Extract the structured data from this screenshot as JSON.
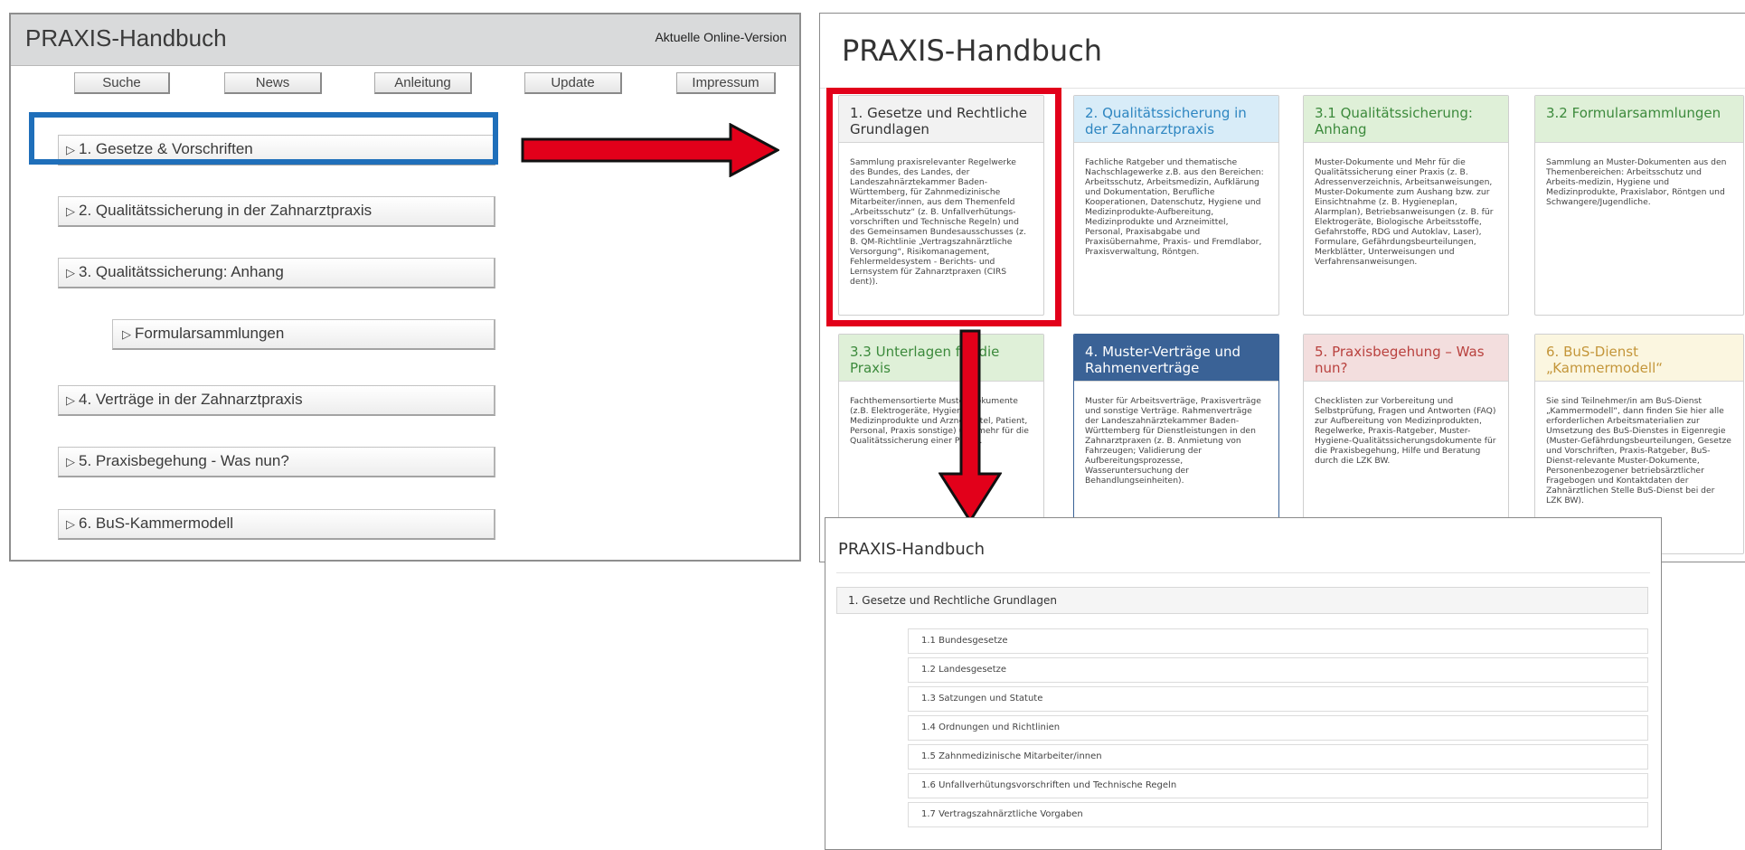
{
  "old_version": {
    "title": "PRAXIS-Handbuch",
    "online_version_link": "Aktuelle Online-Version",
    "buttons": [
      "Suche",
      "News",
      "Anleitung",
      "Update",
      "Impressum"
    ],
    "items": [
      {
        "marker": "▷",
        "label": "1. Gesetze & Vorschriften"
      },
      {
        "marker": "▷",
        "label": "2. Qualitätssicherung in der Zahnarztpraxis"
      },
      {
        "marker": "▷",
        "label": "3. Qualitätssicherung: Anhang"
      },
      {
        "marker": "▷",
        "label": "Formularsammlungen"
      },
      {
        "marker": "▷",
        "label": "4. Verträge in der Zahnarztpraxis"
      },
      {
        "marker": "▷",
        "label": "5. Praxisbegehung - Was nun?"
      },
      {
        "marker": "▷",
        "label": "6. BuS-Kammermodell"
      }
    ],
    "highlight_color": "#1f6fba"
  },
  "new_version": {
    "title": "PRAXIS-Handbuch",
    "highlight_color": "#e2001a",
    "cards": [
      {
        "title": "1. Gesetze und Rechtliche Grundlagen",
        "color": "#f2f2f2",
        "text": "Sammlung praxisrelevanter Regelwerke des Bundes, des Landes, der Landeszahnärztekammer Baden-Württemberg, für Zahnmedizinische Mitarbeiter/innen, aus dem Themenfeld „Arbeitsschutz“ (z. B. Unfallverhütungs-vorschriften und Technische Regeln) und des Gemeinsamen Bundesausschusses (z. B. QM-Richtlinie „Vertragszahnärztliche Versorgung“, Risikomanagement, Fehlermeldesystem - Berichts- und Lernsystem für Zahnarztpraxen (CIRS dent))."
      },
      {
        "title": "2. Qualitätssicherung in der Zahnarztpraxis",
        "color": "#d8ecf8",
        "text": "Fachliche Ratgeber und thematische Nachschlagewerke z.B. aus den Bereichen: Arbeitsschutz, Arbeitsmedizin, Aufklärung und Dokumentation, Berufliche Kooperationen, Datenschutz, Hygiene und Medizinprodukte-Aufbereitung, Medizinprodukte und Arzneimittel, Personal, Praxisabgabe und Praxisübernahme, Praxis- und Fremdlabor, Praxisverwaltung, Röntgen."
      },
      {
        "title": "3.1 Qualitätssicherung: Anhang",
        "color": "#dff0d8",
        "text": "Muster-Dokumente und Mehr für die Qualitätssicherung einer Praxis (z. B. Adressenverzeichnis, Arbeitsanweisungen, Muster-Dokumente zum Aushang bzw. zur Einsichtnahme (z. B. Hygieneplan, Alarmplan), Betriebsanweisungen (z. B. für Elektrogeräte, Biologische Arbeitsstoffe, Gefahrstoffe, RDG und Autoklav, Laser), Formulare, Gefährdungsbeurteilungen, Merkblätter, Unterweisungen und Verfahrensanweisungen."
      },
      {
        "title": "3.2 Formularsammlungen",
        "color": "#dff0d8",
        "text": "Sammlung an Muster-Dokumenten aus den Themenbereichen: Arbeitsschutz und Arbeits-medizin, Hygiene und Medizinprodukte, Praxislabor, Röntgen und Schwangere/Jugendliche."
      },
      {
        "title": "3.3 Unterlagen für die Praxis",
        "color": "#dff0d8",
        "text": "Fachthemensortierte Muster-Dokumente (z.B. Elektrogeräte, Hygiene, Medizinprodukte und Arzneimittel, Patient, Personal, Praxis sonstige) und mehr für die Qualitätssicherung einer Praxis."
      },
      {
        "title": "4. Muster-Verträge und Rahmenverträge",
        "color": "#3a6296",
        "text": "Muster für Arbeitsverträge, Praxisverträge und sonstige Verträge. Rahmenverträge der Landeszahnärztekammer Baden-Württemberg für Dienstleistungen in den Zahnarztpraxen (z. B. Anmietung von Fahrzeugen; Validierung der Aufbereitungsprozesse, Wasseruntersuchung der Behandlungseinheiten)."
      },
      {
        "title": "5. Praxisbegehung – Was nun?",
        "color": "#f3dede",
        "text": "Checklisten zur Vorbereitung und Selbstprüfung, Fragen und Antworten (FAQ) zur Aufbereitung von Medizinprodukten, Regelwerke, Praxis-Ratgeber, Muster-Hygiene-Qualitätssicherungsdokumente für die Praxisbegehung, Hilfe und Beratung durch die LZK BW."
      },
      {
        "title": "6. BuS-Dienst „Kammermodell“",
        "color": "#fbf6e0",
        "text": "Sie sind Teilnehmer/in am BuS-Dienst „Kammermodell“, dann finden Sie hier alle erforderlichen Arbeitsmaterialien zur Umsetzung des BuS-Dienstes in Eigenregie (Muster-Gefährdungsbeurteilungen, Gesetze und Vorschriften, Praxis-Ratgeber, BuS-Dienst-relevante Muster-Dokumente, Personenbezogener betriebsärztlicher Fragebogen und Kontaktdaten der Zahnärztlichen Stelle BuS-Dienst bei der LZK BW)."
      }
    ]
  },
  "detail_view": {
    "title": "PRAXIS-Handbuch",
    "section": "1. Gesetze und Rechtliche Grundlagen",
    "items": [
      "1.1 Bundesgesetze",
      "1.2 Landesgesetze",
      "1.3 Satzungen und Statute",
      "1.4 Ordnungen und Richtlinien",
      "1.5 Zahnmedizinische Mitarbeiter/innen",
      "1.6 Unfallverhütungsvorschriften und Technische Regeln",
      "1.7 Vertragszahnärztliche Vorgaben"
    ]
  },
  "arrow_color": "#e2001a"
}
